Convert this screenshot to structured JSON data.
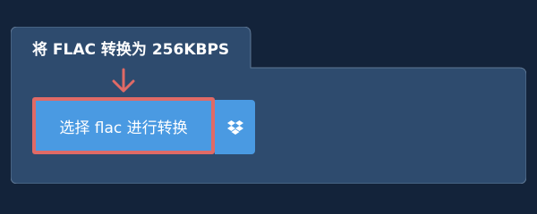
{
  "panel": {
    "tab_title": "将 FLAC 转换为 256KBPS"
  },
  "actions": {
    "convert_label": "选择 flac 进行转换",
    "dropbox_icon": "dropbox-icon",
    "pointer_icon": "arrow-down-icon"
  },
  "colors": {
    "page_background": "#13233a",
    "panel_background": "#2e4b6e",
    "panel_border": "#5f7895",
    "button_primary": "#4a9ae2",
    "highlight_outline": "#e06a66",
    "arrow_color": "#e06a66",
    "text": "#ffffff"
  }
}
